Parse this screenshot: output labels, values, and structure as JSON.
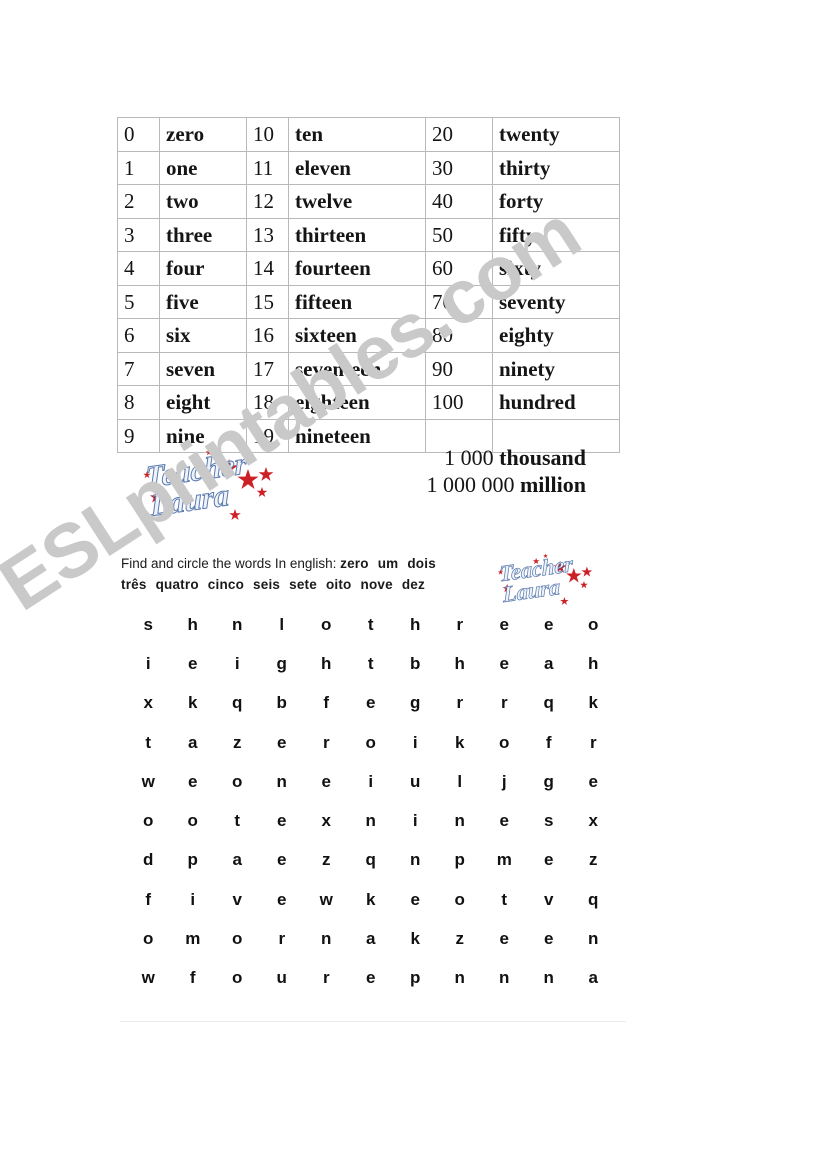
{
  "watermark": {
    "text": "ESLprintables.com",
    "color": "#c9c9c9"
  },
  "numbers_table": {
    "rows": [
      {
        "n1": "0",
        "w1": "zero",
        "n2": "10",
        "w2": "ten",
        "n3": "20",
        "w3": "twenty"
      },
      {
        "n1": "1",
        "w1": "one",
        "n2": "11",
        "w2": "eleven",
        "n3": "30",
        "w3": "thirty"
      },
      {
        "n1": "2",
        "w1": "two",
        "n2": "12",
        "w2": "twelve",
        "n3": "40",
        "w3": "forty"
      },
      {
        "n1": "3",
        "w1": "three",
        "n2": "13",
        "w2": "thirteen",
        "n3": "50",
        "w3": "fifty"
      },
      {
        "n1": "4",
        "w1": "four",
        "n2": "14",
        "w2": "fourteen",
        "n3": "60",
        "w3": "sixty"
      },
      {
        "n1": "5",
        "w1": "five",
        "n2": "15",
        "w2": "fifteen",
        "n3": "70",
        "w3": "seventy"
      },
      {
        "n1": "6",
        "w1": "six",
        "n2": "16",
        "w2": "sixteen",
        "n3": "80",
        "w3": "eighty"
      },
      {
        "n1": "7",
        "w1": "seven",
        "n2": "17",
        "w2": "seventeen",
        "n3": "90",
        "w3": "ninety"
      },
      {
        "n1": "8",
        "w1": "eight",
        "n2": "18",
        "w2": "eighteen",
        "n3": "100",
        "w3": "hundred"
      },
      {
        "n1": "9",
        "w1": "nine",
        "n2": "19",
        "w2": "nineteen",
        "n3": "",
        "w3": ""
      }
    ]
  },
  "big_numbers": [
    {
      "amount": "1 000",
      "word": "thousand"
    },
    {
      "amount": "1 000 000",
      "word": "million"
    }
  ],
  "logo": {
    "line1": "Teacher",
    "line2": "Laura",
    "script_color": "#5878ad",
    "star_color": "#cc2026"
  },
  "exercise": {
    "instruction": "Find and circle the words In english:",
    "portuguese_words_line1": [
      "zero",
      "um",
      "dois"
    ],
    "portuguese_words_line2": [
      "três",
      "quatro",
      "cinco",
      "seis",
      "sete",
      "oito",
      "nove",
      "dez"
    ]
  },
  "wordsearch": {
    "rows": [
      [
        "s",
        "h",
        "n",
        "l",
        "o",
        "t",
        "h",
        "r",
        "e",
        "e",
        "o"
      ],
      [
        "i",
        "e",
        "i",
        "g",
        "h",
        "t",
        "b",
        "h",
        "e",
        "a",
        "h"
      ],
      [
        "x",
        "k",
        "q",
        "b",
        "f",
        "e",
        "g",
        "r",
        "r",
        "q",
        "k"
      ],
      [
        "t",
        "a",
        "z",
        "e",
        "r",
        "o",
        "i",
        "k",
        "o",
        "f",
        "r"
      ],
      [
        "w",
        "e",
        "o",
        "n",
        "e",
        "i",
        "u",
        "l",
        "j",
        "g",
        "e"
      ],
      [
        "o",
        "o",
        "t",
        "e",
        "x",
        "n",
        "i",
        "n",
        "e",
        "s",
        "x"
      ],
      [
        "d",
        "p",
        "a",
        "e",
        "z",
        "q",
        "n",
        "p",
        "m",
        "e",
        "z"
      ],
      [
        "f",
        "i",
        "v",
        "e",
        "w",
        "k",
        "e",
        "o",
        "t",
        "v",
        "q"
      ],
      [
        "o",
        "m",
        "o",
        "r",
        "n",
        "a",
        "k",
        "z",
        "e",
        "e",
        "n"
      ],
      [
        "w",
        "f",
        "o",
        "u",
        "r",
        "e",
        "p",
        "n",
        "n",
        "n",
        "a"
      ]
    ]
  }
}
